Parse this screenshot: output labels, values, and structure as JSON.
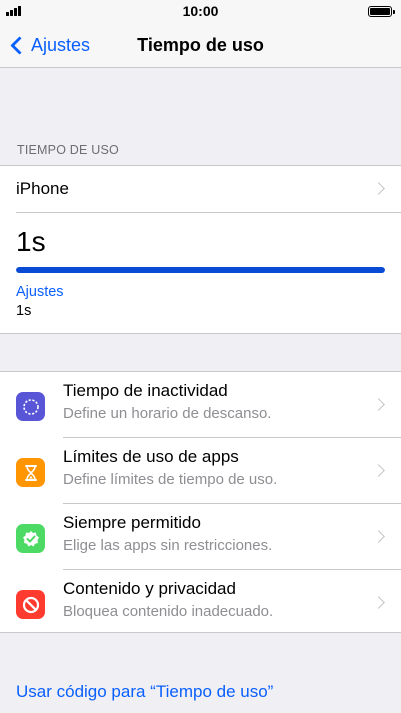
{
  "status_bar": {
    "time": "10:00"
  },
  "nav": {
    "back_label": "Ajustes",
    "title": "Tiempo de uso"
  },
  "usage": {
    "section_header": "TIEMPO DE USO",
    "device": "iPhone",
    "total": "1s",
    "bar_fraction": 1.0,
    "app_name": "Ajustes",
    "app_time": "1s"
  },
  "settings": [
    {
      "title": "Tiempo de inactividad",
      "subtitle": "Define un horario de descanso.",
      "icon": "downtime-icon",
      "color": "#5856d6"
    },
    {
      "title": "Límites de uso de apps",
      "subtitle": "Define límites de tiempo de uso.",
      "icon": "hourglass-icon",
      "color": "#ff9500"
    },
    {
      "title": "Siempre permitido",
      "subtitle": "Elige las apps sin restricciones.",
      "icon": "checkmark-badge-icon",
      "color": "#4cd964"
    },
    {
      "title": "Contenido y privacidad",
      "subtitle": "Bloquea contenido inadecuado.",
      "icon": "restriction-icon",
      "color": "#ff3b30"
    }
  ],
  "footer": {
    "passcode_link": "Usar código para “Tiempo de uso”"
  },
  "colors": {
    "accent": "#0a60fe",
    "usage_bar": "#0a4bd6"
  }
}
